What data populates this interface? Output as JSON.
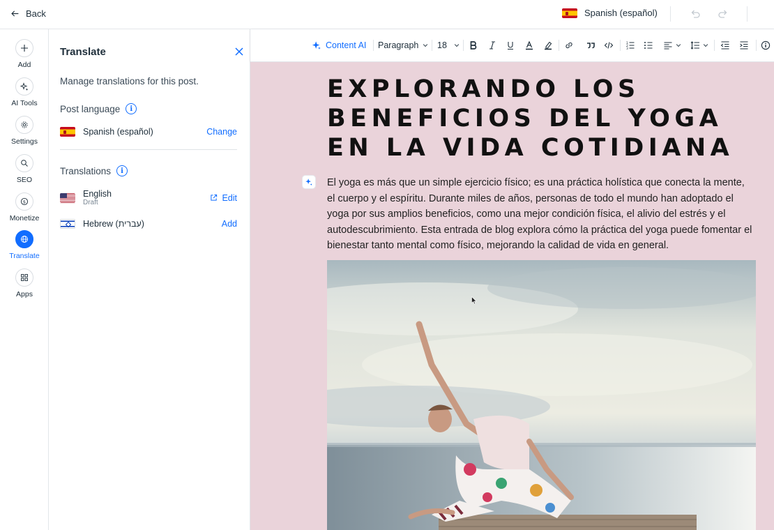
{
  "topbar": {
    "back_label": "Back",
    "language_label": "Spanish (español)"
  },
  "rail": {
    "items": [
      {
        "label": "Add",
        "icon": "plus-icon"
      },
      {
        "label": "AI Tools",
        "icon": "sparkle-icon"
      },
      {
        "label": "Settings",
        "icon": "gear-icon"
      },
      {
        "label": "SEO",
        "icon": "search-icon"
      },
      {
        "label": "Monetize",
        "icon": "dollar-icon"
      },
      {
        "label": "Translate",
        "icon": "globe-icon"
      },
      {
        "label": "Apps",
        "icon": "apps-icon"
      }
    ],
    "active": "Translate"
  },
  "panel": {
    "title": "Translate",
    "description": "Manage translations for this post.",
    "post_language_heading": "Post language",
    "post_language": {
      "name": "Spanish (español)",
      "action": "Change"
    },
    "translations_heading": "Translations",
    "translations": [
      {
        "name": "English",
        "status": "Draft",
        "action": "Edit"
      },
      {
        "name": "Hebrew (עברית)",
        "status": "",
        "action": "Add"
      }
    ]
  },
  "toolbar": {
    "content_ai_label": "Content AI",
    "paragraph_label": "Paragraph",
    "font_size": "18"
  },
  "post": {
    "title": "Explorando los beneficios del yoga en la vida cotidiana",
    "body": "El yoga es más que un simple ejercicio físico; es una práctica holística que conecta la mente, el cuerpo y el espíritu. Durante miles de años, personas de todo el mundo han adoptado el yoga por sus amplios beneficios, como una mejor condición física, el alivio del estrés y el autodescubrimiento. Esta entrada de blog explora cómo la práctica del yoga puede fomentar el bienestar tanto mental como físico, mejorando la calidad de vida en general."
  },
  "colors": {
    "accent": "#116dff",
    "canvas_background": "#ead3da",
    "text": "#20303c"
  }
}
